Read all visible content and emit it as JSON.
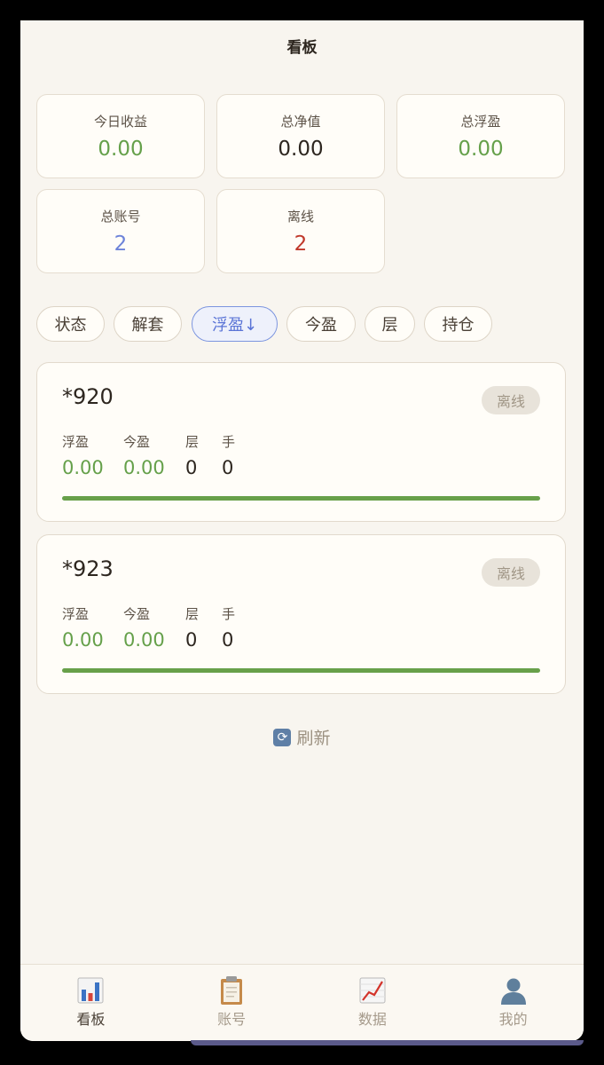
{
  "header": {
    "title": "看板"
  },
  "summary": [
    {
      "label": "今日收益",
      "value": "0.00",
      "color": "#65a04a"
    },
    {
      "label": "总净值",
      "value": "0.00",
      "color": "#2d261f"
    },
    {
      "label": "总浮盈",
      "value": "0.00",
      "color": "#65a04a"
    },
    {
      "label": "总账号",
      "value": "2",
      "color": "#6d83d9"
    },
    {
      "label": "离线",
      "value": "2",
      "color": "#c0392b"
    }
  ],
  "sort_chips": [
    {
      "label": "状态",
      "active": false
    },
    {
      "label": "解套",
      "active": false
    },
    {
      "label": "浮盈↓",
      "active": true
    },
    {
      "label": "今盈",
      "active": false
    },
    {
      "label": "层",
      "active": false
    },
    {
      "label": "持仓",
      "active": false
    }
  ],
  "accounts": [
    {
      "name": "*920",
      "status": "离线",
      "metrics": [
        {
          "label": "浮盈",
          "value": "0.00",
          "color": "#65a04a"
        },
        {
          "label": "今盈",
          "value": "0.00",
          "color": "#65a04a"
        },
        {
          "label": "层",
          "value": "0",
          "color": "#2d261f"
        },
        {
          "label": "手",
          "value": "0",
          "color": "#2d261f"
        }
      ],
      "progress": 1.0
    },
    {
      "name": "*923",
      "status": "离线",
      "metrics": [
        {
          "label": "浮盈",
          "value": "0.00",
          "color": "#65a04a"
        },
        {
          "label": "今盈",
          "value": "0.00",
          "color": "#65a04a"
        },
        {
          "label": "层",
          "value": "0",
          "color": "#2d261f"
        },
        {
          "label": "手",
          "value": "0",
          "color": "#2d261f"
        }
      ],
      "progress": 1.0
    }
  ],
  "refresh": {
    "label": "刷新",
    "icon": "refresh-icon"
  },
  "tabbar": [
    {
      "label": "看板",
      "icon": "bar-chart-icon",
      "active": true
    },
    {
      "label": "账号",
      "icon": "clipboard-icon",
      "active": false
    },
    {
      "label": "数据",
      "icon": "line-chart-icon",
      "active": false
    },
    {
      "label": "我的",
      "icon": "user-icon",
      "active": false
    }
  ]
}
